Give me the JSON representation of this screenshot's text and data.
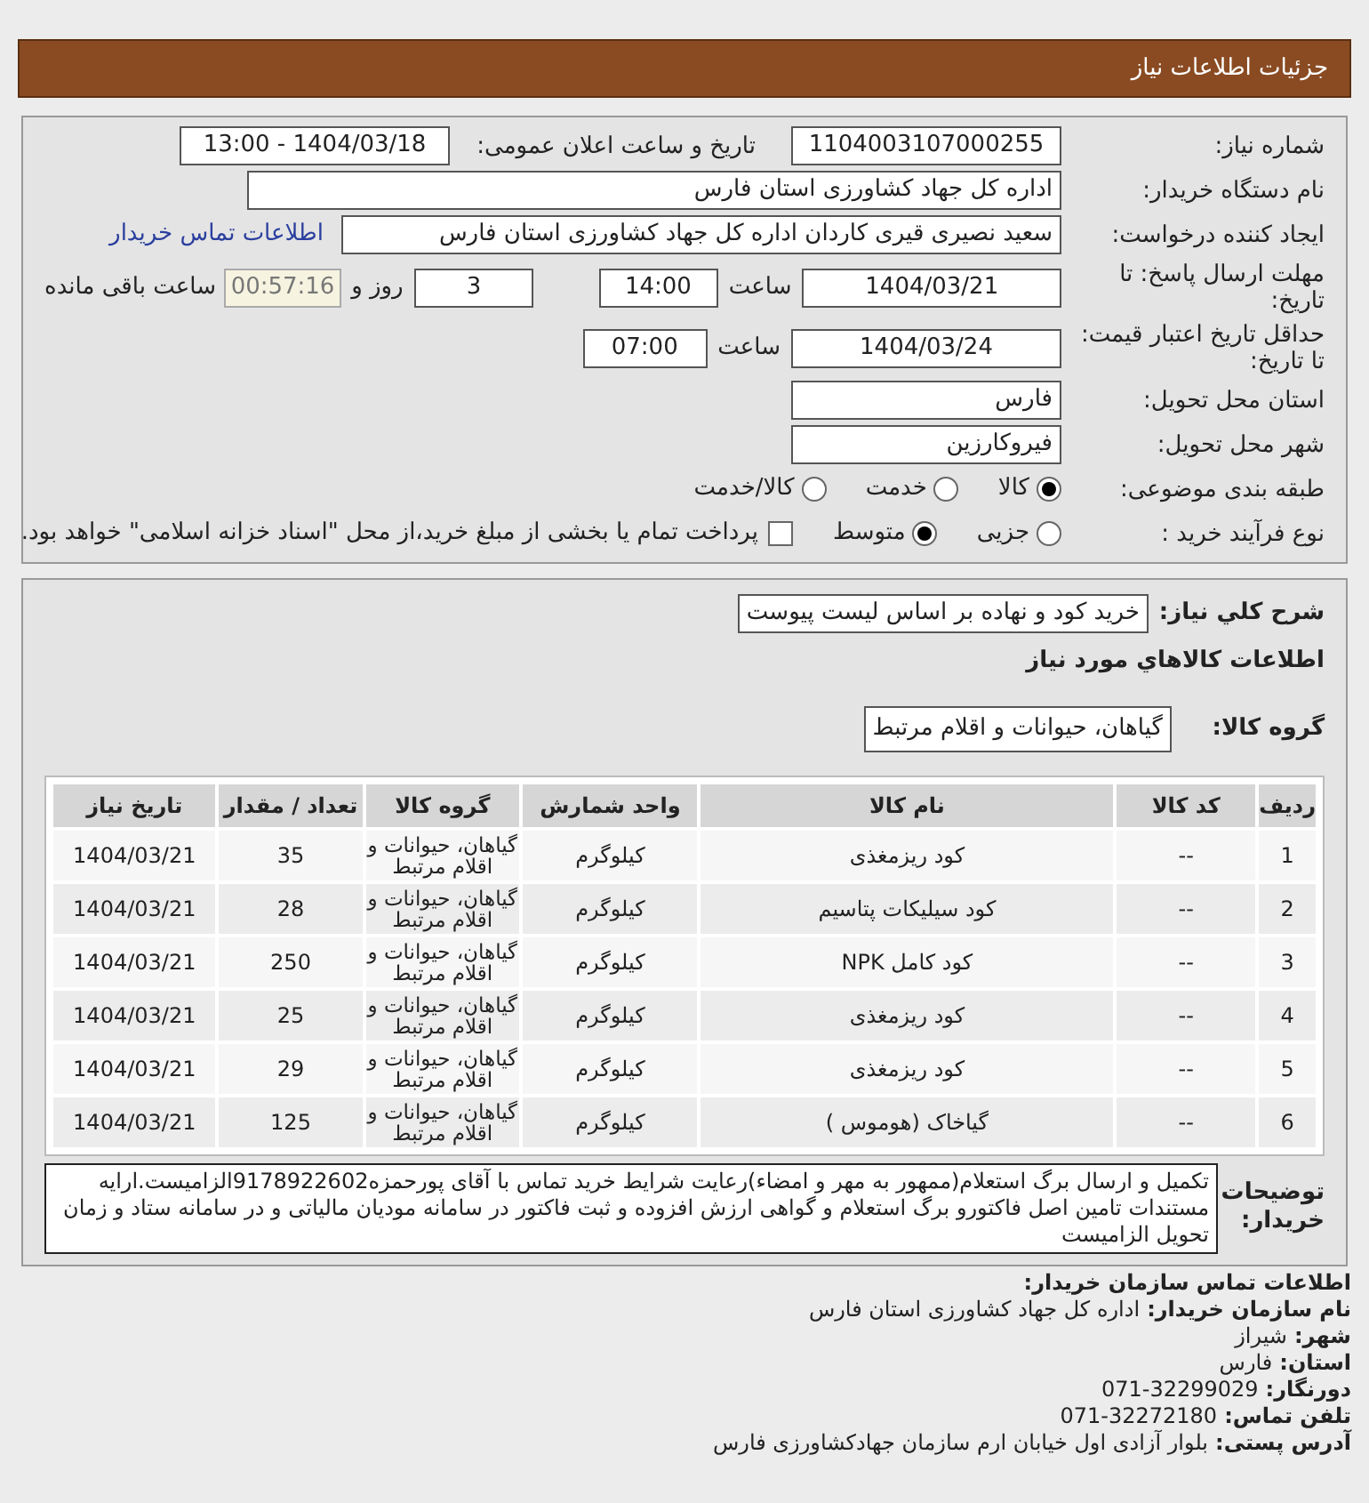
{
  "header": {
    "title": "جزئیات اطلاعات نیاز"
  },
  "need_number": {
    "label": "شماره نیاز:",
    "value": "1104003107000255"
  },
  "announce": {
    "label": "تاریخ و ساعت اعلان عمومی:",
    "value": "1404/03/18 - 13:00"
  },
  "buyer_org": {
    "label": "نام دستگاه خریدار:",
    "value": "اداره کل جهاد کشاورزی استان فارس"
  },
  "requester": {
    "label": "ایجاد کننده درخواست:",
    "value": "سعید نصیری قیری کاردان اداره کل جهاد کشاورزی استان فارس",
    "link": "اطلاعات تماس خریدار"
  },
  "deadline": {
    "label": "مهلت ارسال پاسخ: تا تاریخ:",
    "date": "1404/03/21",
    "time_label": "ساعت",
    "time": "14:00",
    "days": "3",
    "days_label": "روز و",
    "remaining": "00:57:16",
    "remaining_label": "ساعت باقی مانده"
  },
  "validity": {
    "label": "حداقل تاریخ اعتبار قیمت: تا تاریخ:",
    "date": "1404/03/24",
    "time_label": "ساعت",
    "time": "07:00"
  },
  "province": {
    "label": "استان محل تحویل:",
    "value": "فارس"
  },
  "city": {
    "label": "شهر محل تحویل:",
    "value": "فیروکارزین"
  },
  "category": {
    "label": "طبقه بندی موضوعی:",
    "options": [
      {
        "label": "کالا",
        "selected": true
      },
      {
        "label": "خدمت",
        "selected": false
      },
      {
        "label": "کالا/خدمت",
        "selected": false
      }
    ]
  },
  "process": {
    "label": "نوع فرآیند خرید :",
    "options": [
      {
        "label": "جزیی",
        "selected": false
      },
      {
        "label": "متوسط",
        "selected": true
      }
    ],
    "payment": {
      "checked": false,
      "label": "پرداخت تمام یا بخشی از مبلغ خرید،از محل \"اسناد خزانه اسلامی\" خواهد بود."
    }
  },
  "summary": {
    "label": "شرح کلي نياز:",
    "value": "خرید کود و نهاده بر اساس لیست پیوست"
  },
  "goods_title": "اطلاعات کالاهاي مورد نياز",
  "group": {
    "label": "گروه کالا:",
    "value": "گیاهان، حیوانات و اقلام مرتبط"
  },
  "table": {
    "columns": [
      "ردیف",
      "کد کالا",
      "نام کالا",
      "واحد شمارش",
      "گروه کالا",
      "تعداد / مقدار",
      "تاریخ نیاز"
    ],
    "rows": [
      [
        "1",
        "--",
        "کود ریزمغذی",
        "کیلوگرم",
        "گیاهان، حیوانات و اقلام مرتبط",
        "35",
        "1404/03/21"
      ],
      [
        "2",
        "--",
        "کود سیلیکات پتاسیم",
        "کیلوگرم",
        "گیاهان، حیوانات و اقلام مرتبط",
        "28",
        "1404/03/21"
      ],
      [
        "3",
        "--",
        "کود کامل NPK",
        "کیلوگرم",
        "گیاهان، حیوانات و اقلام مرتبط",
        "250",
        "1404/03/21"
      ],
      [
        "4",
        "--",
        "کود ریزمغذی",
        "کیلوگرم",
        "گیاهان، حیوانات و اقلام مرتبط",
        "25",
        "1404/03/21"
      ],
      [
        "5",
        "--",
        "کود ریزمغذی",
        "کیلوگرم",
        "گیاهان، حیوانات و اقلام مرتبط",
        "29",
        "1404/03/21"
      ],
      [
        "6",
        "--",
        "گیاخاک (هوموس )",
        "کیلوگرم",
        "گیاهان، حیوانات و اقلام مرتبط",
        "125",
        "1404/03/21"
      ]
    ]
  },
  "notes": {
    "label": "توضیحات خریدار:",
    "value": "تکمیل و ارسال برگ استعلام(ممهور به مهر و امضاء)رعایت شرایط خرید تماس با آقای پورحمزه9178922602الزامیست.ارایه مستندات تامین اصل فاکتورو برگ استعلام و گواهی ارزش افزوده و ثبت فاکتور در سامانه مودیان مالیاتی و در سامانه ستاد و زمان تحویل الزامیست"
  },
  "contact": {
    "title": "اطلاعات تماس سازمان خریدار:",
    "lines": [
      {
        "label": "نام سازمان خریدار:",
        "value": "اداره کل جهاد کشاورزی استان فارس"
      },
      {
        "label": "شهر:",
        "value": "شیراز"
      },
      {
        "label": "استان:",
        "value": "فارس"
      },
      {
        "label": "دورنگار:",
        "value": "071-32299029"
      },
      {
        "label": "تلفن تماس:",
        "value": "071-32272180"
      },
      {
        "label": "آدرس پستی:",
        "value": "بلوار آزادی اول خیابان ارم سازمان جهادکشاورزی فارس"
      }
    ]
  }
}
